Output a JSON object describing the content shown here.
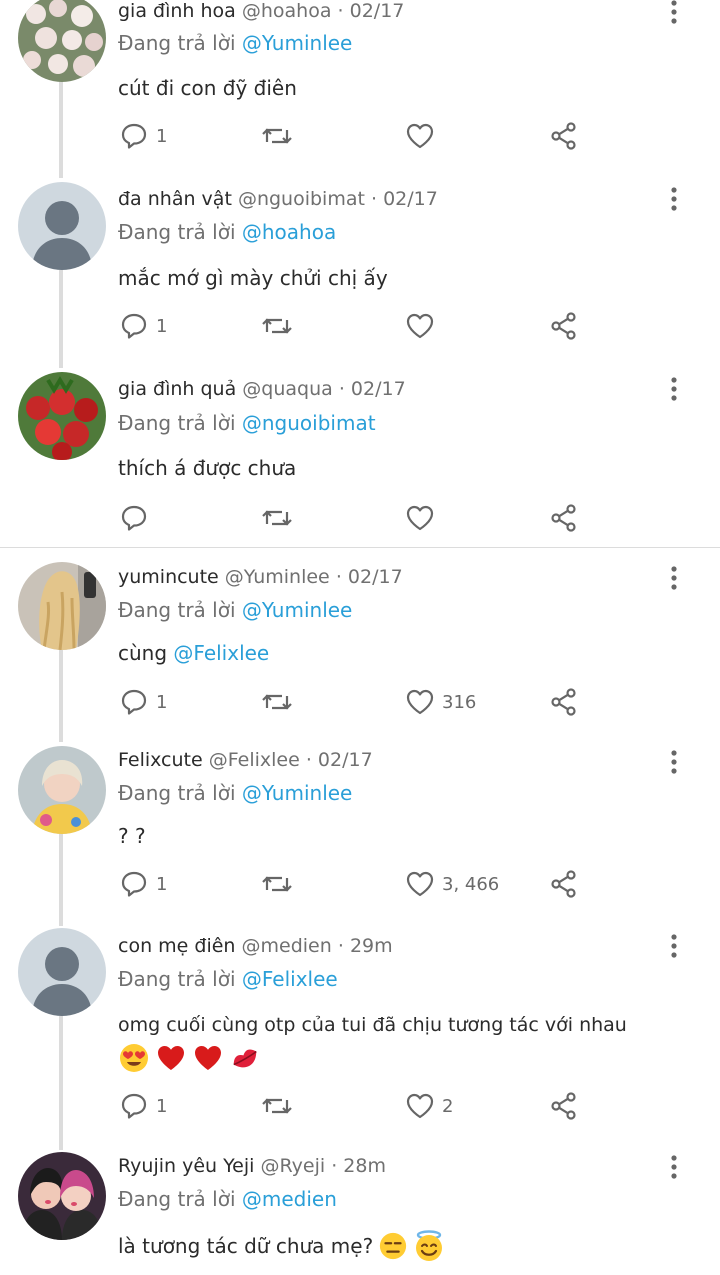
{
  "reply_prefix": "Đang trả lời",
  "tweets": [
    {
      "name": "gia đình hoa",
      "handle": "@hoahoa",
      "dot": "·",
      "time": "02/17",
      "reply_to": "@Yuminlee",
      "text": "cút đi con đỹ điên",
      "reply_count": "1",
      "like_count": ""
    },
    {
      "name": "đa nhân vật",
      "handle": "@nguoibimat",
      "dot": "·",
      "time": "02/17",
      "reply_to": "@hoahoa",
      "text": "mắc mớ gì mày chửi chị ấy",
      "reply_count": "1",
      "like_count": ""
    },
    {
      "name": "gia đình quả",
      "handle": "@quaqua",
      "dot": "·",
      "time": "02/17",
      "reply_to": "@nguoibimat",
      "text": "thích á được chưa",
      "reply_count": "",
      "like_count": ""
    },
    {
      "name": "yumincute",
      "handle": "@Yuminlee",
      "dot": "·",
      "time": "02/17",
      "reply_to": "@Yuminlee",
      "text": "cùng",
      "text_mention": "@Felixlee",
      "reply_count": "1",
      "like_count": "316"
    },
    {
      "name": "Felixcute",
      "handle": "@Felixlee",
      "dot": "·",
      "time": "02/17",
      "reply_to": "@Yuminlee",
      "text": "? ?",
      "reply_count": "1",
      "like_count": "3, 466"
    },
    {
      "name": "con mẹ điên",
      "handle": "@medien",
      "dot": "·",
      "time": "29m",
      "reply_to": "@Felixlee",
      "text": "omg cuối cùng otp của tui đã chịu tương tác với nhau",
      "reply_count": "1",
      "like_count": "2"
    },
    {
      "name": "Ryujin yêu Yeji",
      "handle": "@Ryeji",
      "dot": "·",
      "time": "28m",
      "reply_to": "@medien",
      "text": "là tương tác dữ chưa mẹ?",
      "reply_count": "",
      "like_count": ""
    }
  ],
  "icons": {
    "reply": "reply-icon",
    "retweet": "retweet-icon",
    "like": "heart-icon",
    "share": "share-icon",
    "more": "more-vertical-icon"
  },
  "colors": {
    "mention": "#2a9fd8",
    "muted": "#707070",
    "line": "#dcdcdc"
  }
}
